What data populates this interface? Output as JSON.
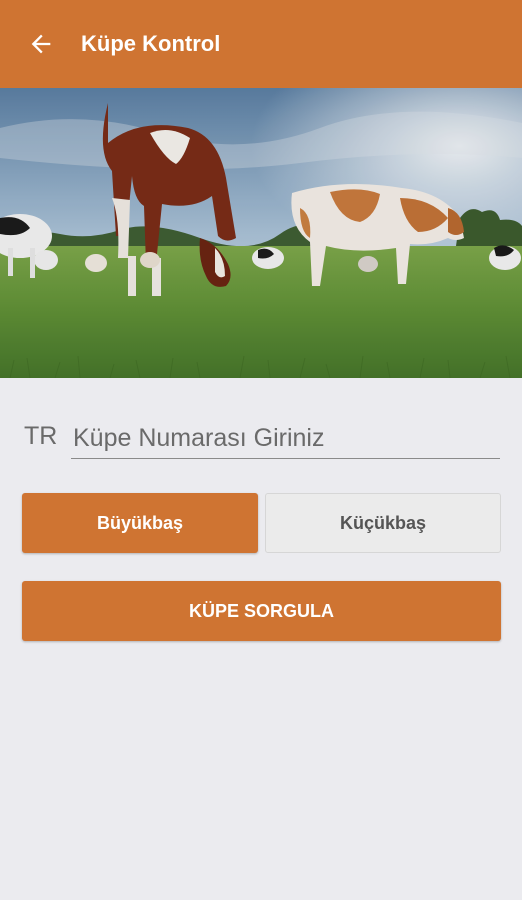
{
  "header": {
    "title": "Küpe Kontrol",
    "background": "#cf7432",
    "back_icon": "arrow-left-icon"
  },
  "hero": {
    "subject": "cows grazing in pasture"
  },
  "form": {
    "prefix": "TR",
    "ear_tag_placeholder": "Küpe Numarası Giriniz",
    "ear_tag_value": ""
  },
  "animal_type": {
    "cattle_label": "Büyükbaş",
    "small_ruminant_label": "Küçükbaş",
    "selected": "Büyükbaş"
  },
  "actions": {
    "query_label": "KÜPE SORGULA"
  },
  "colors": {
    "accent": "#cf7432",
    "background": "#ebebef",
    "inactive_button": "#ebebeb"
  }
}
